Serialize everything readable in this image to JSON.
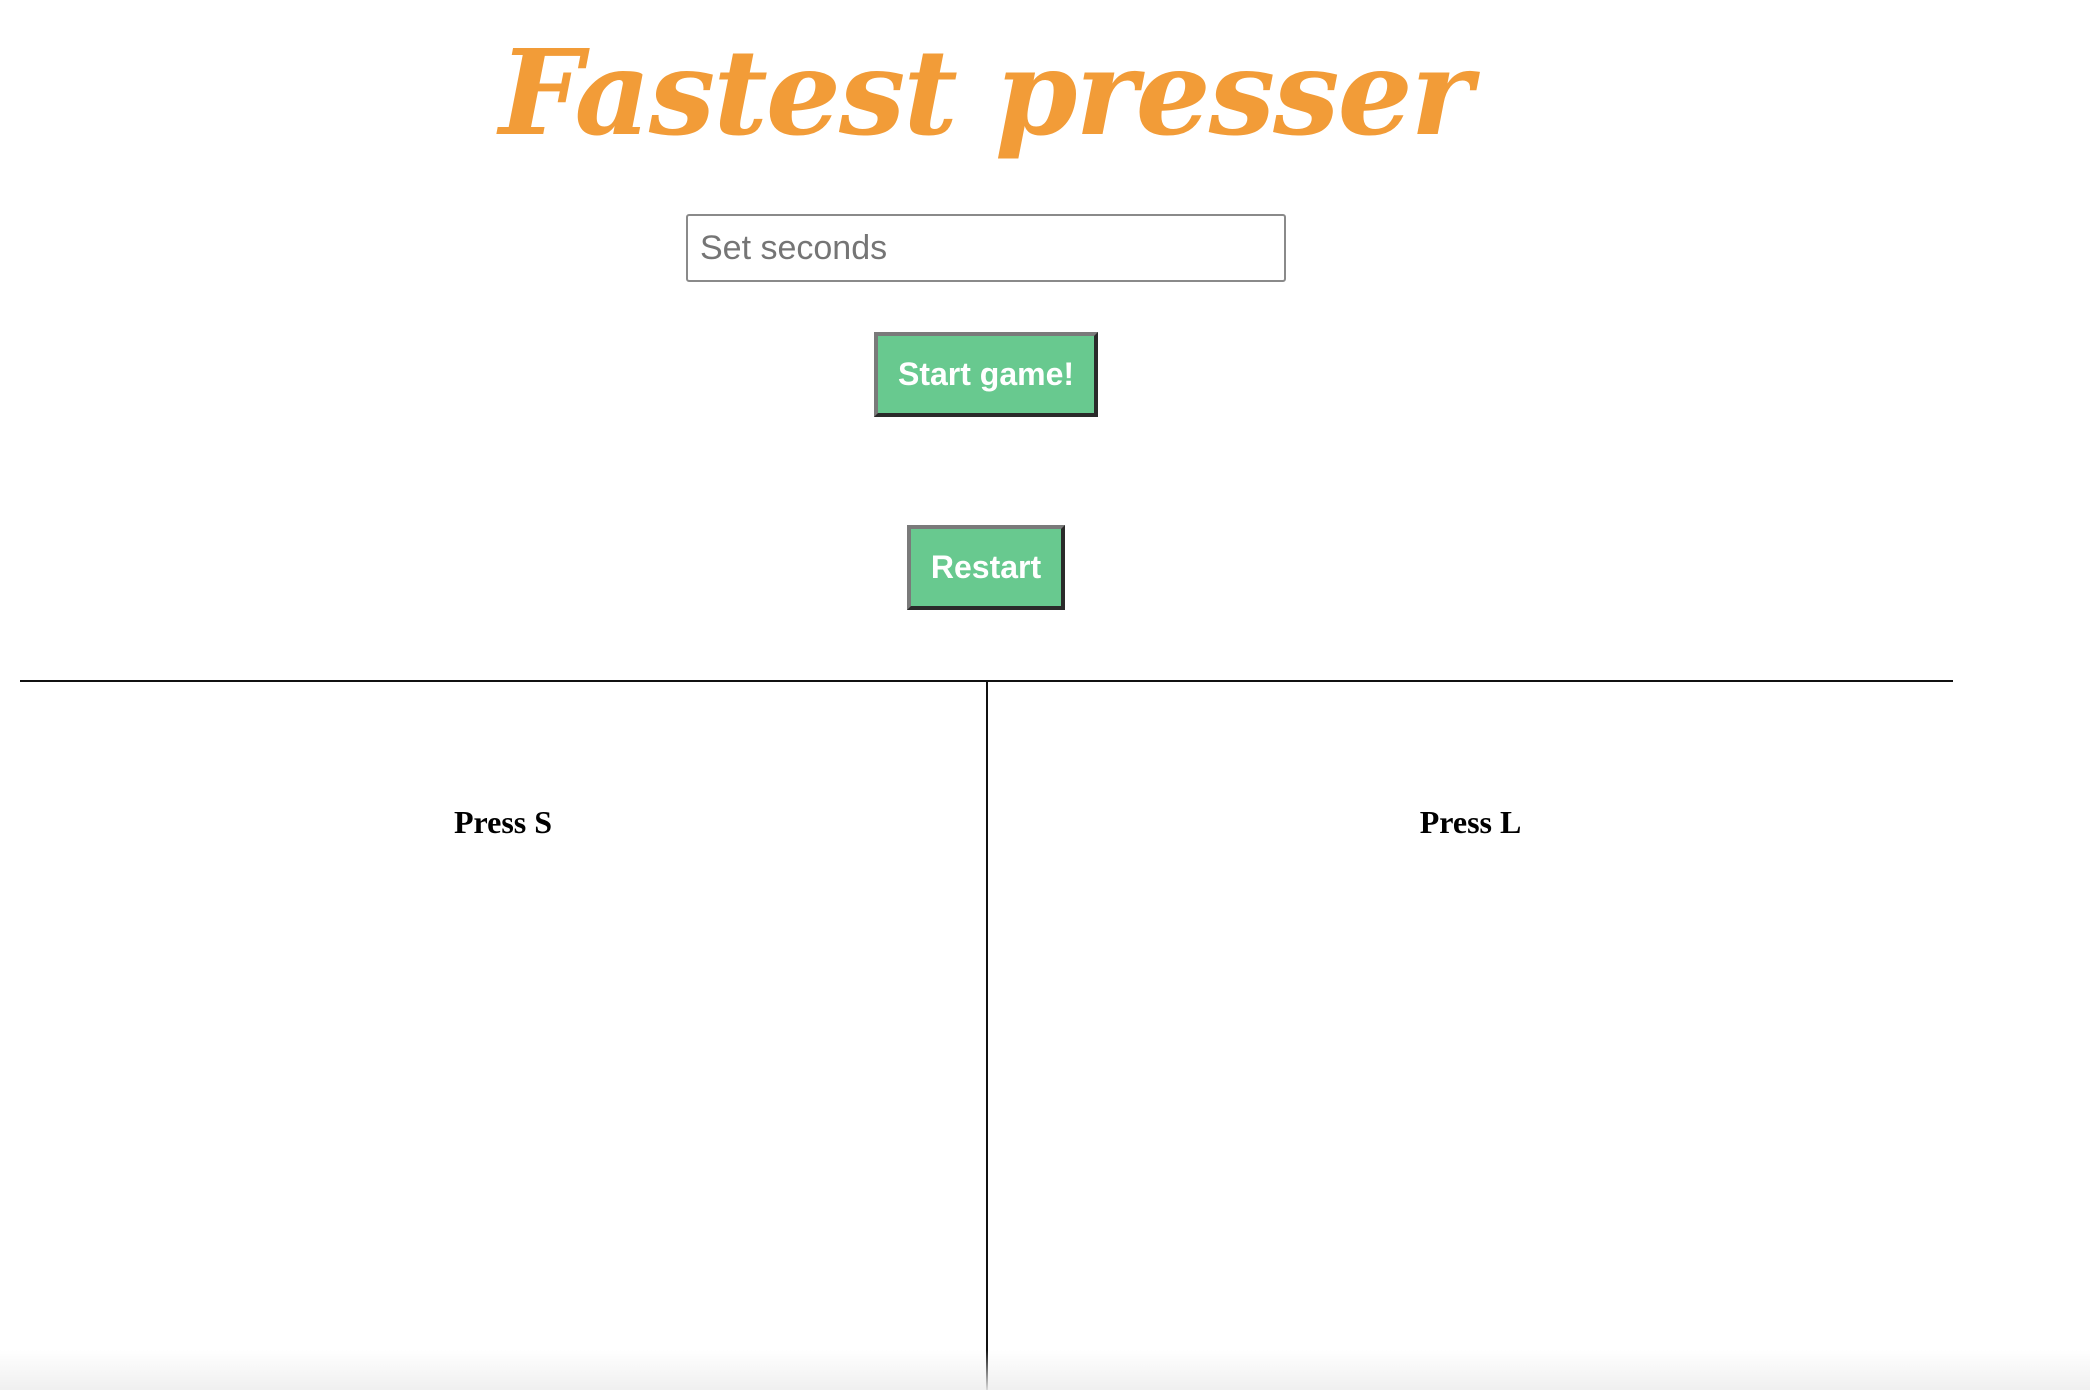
{
  "header": {
    "title": "Fastest presser"
  },
  "controls": {
    "seconds_placeholder": "Set seconds",
    "seconds_value": "",
    "start_label": "Start game!",
    "restart_label": "Restart"
  },
  "players": [
    {
      "label": "Press S"
    },
    {
      "label": "Press L"
    }
  ],
  "colors": {
    "title": "#f29c38",
    "button": "#68c98f",
    "button_text": "#ffffff",
    "divider": "#111111"
  }
}
